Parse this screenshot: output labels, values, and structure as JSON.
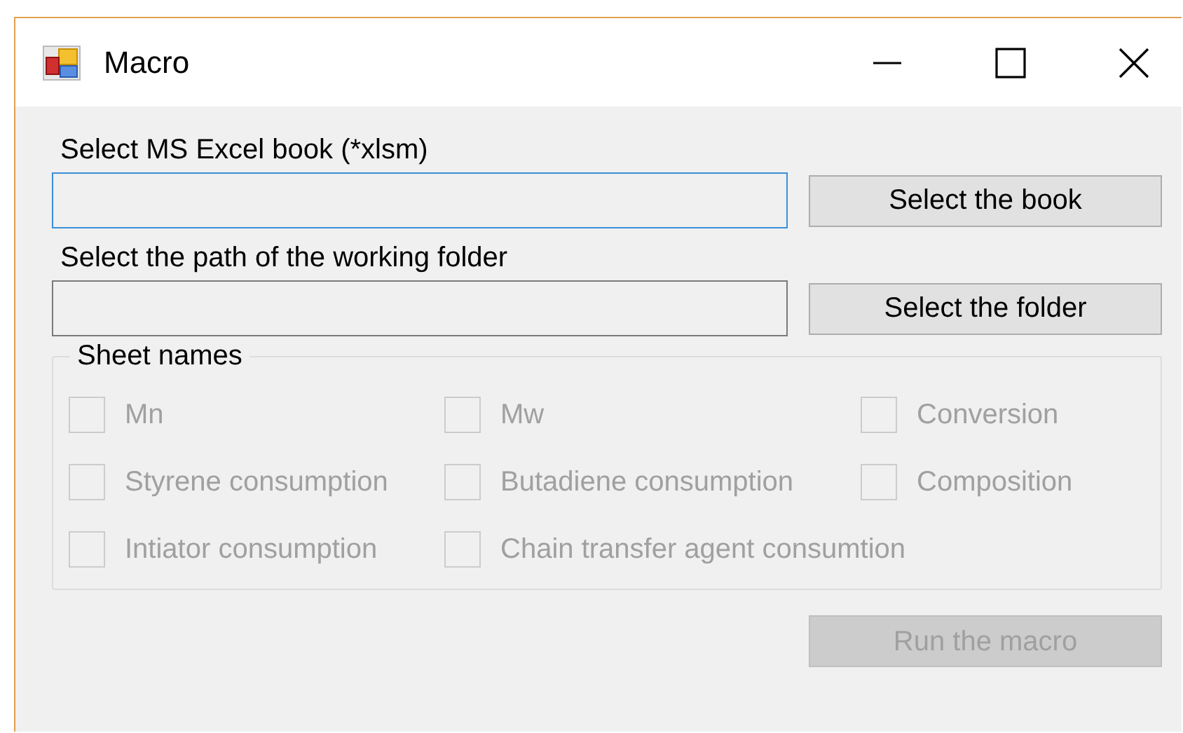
{
  "window": {
    "title": "Macro"
  },
  "book": {
    "label": "Select MS Excel book (*xlsm)",
    "focused": true,
    "button": {
      "label": "Select the book",
      "disabled": false
    }
  },
  "folder": {
    "label": "Select the path of the working folder",
    "focused": false,
    "button": {
      "label": "Select the folder",
      "disabled": false
    }
  },
  "sheet_names": {
    "title": "Sheet names",
    "items": [
      {
        "label": "Mn",
        "checked": false,
        "disabled": true
      },
      {
        "label": "Mw",
        "checked": false,
        "disabled": true
      },
      {
        "label": "Conversion",
        "checked": false,
        "disabled": true
      },
      {
        "label": "Styrene consumption",
        "checked": false,
        "disabled": true
      },
      {
        "label": "Butadiene consumption",
        "checked": false,
        "disabled": true
      },
      {
        "label": "Composition",
        "checked": false,
        "disabled": true
      },
      {
        "label": "Intiator consumption",
        "checked": false,
        "disabled": true
      },
      {
        "label": "Chain transfer agent consumtion",
        "checked": false,
        "disabled": true
      }
    ]
  },
  "run_button": {
    "label": "Run the macro",
    "disabled": true
  }
}
